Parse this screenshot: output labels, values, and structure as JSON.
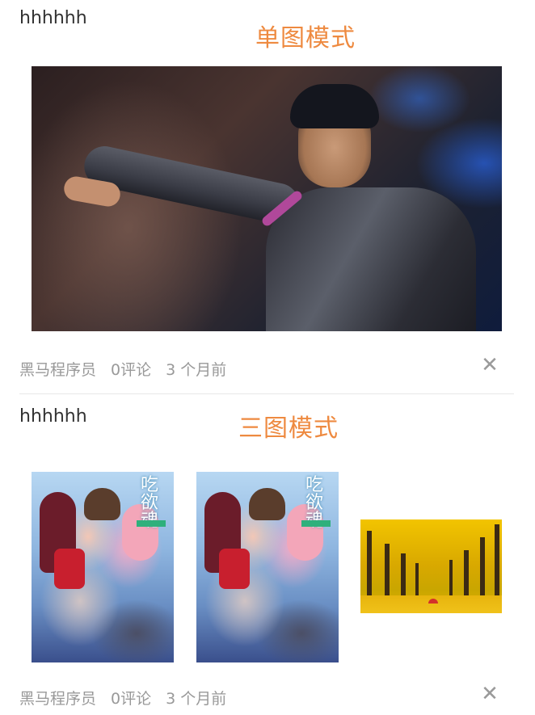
{
  "articles": [
    {
      "title": "hhhhhh",
      "mode_label": "单图模式",
      "images": [
        {
          "kind": "concert-photo"
        }
      ],
      "meta": {
        "author": "黑马程序员",
        "comments": "0评论",
        "time": "3 个月前"
      },
      "close_icon": "close-icon"
    },
    {
      "title": "hhhhhh",
      "mode_label": "三图模式",
      "images": [
        {
          "kind": "anime-cover",
          "cover_text": "吃欲魂"
        },
        {
          "kind": "anime-cover",
          "cover_text": "吃欲魂"
        },
        {
          "kind": "yellow-trees-photo"
        }
      ],
      "meta": {
        "author": "黑马程序员",
        "comments": "0评论",
        "time": "3 个月前"
      },
      "close_icon": "close-icon"
    }
  ],
  "colors": {
    "mode_label": "#ee8a40",
    "meta_text": "#999999",
    "title_text": "#333333",
    "divider": "#e8e8e8"
  }
}
